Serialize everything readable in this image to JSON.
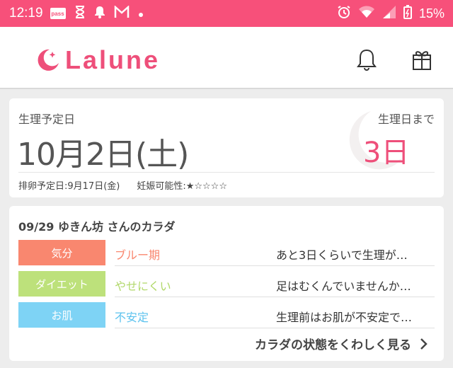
{
  "status_bar": {
    "time": "12:19",
    "pass_badge": "pass",
    "battery_percent": "15%",
    "icons": [
      "pass-icon",
      "hourglass-icon",
      "bell-icon",
      "gmail-icon",
      "dot-icon",
      "alarm-icon",
      "wifi-icon",
      "signal-icon",
      "battery-icon"
    ]
  },
  "header": {
    "logo_text": "Lalune",
    "icons": [
      "notification-bell-icon",
      "gift-icon"
    ]
  },
  "period": {
    "label": "生理予定日",
    "date": "10月2日(土)",
    "days_label": "生理日まで",
    "days_value": "3日",
    "ovulation": "排卵予定日:9月17日(金)",
    "pregnancy": "妊娠可能性:★☆☆☆☆"
  },
  "body": {
    "title": "09/29  ゆきん坊 さんのカラダ",
    "rows": [
      {
        "tag": "気分",
        "status": "ブルー期",
        "desc": "あと3日くらいで生理が…",
        "tag_color": "#f9876f",
        "status_color": "#f9876f"
      },
      {
        "tag": "ダイエット",
        "status": "やせにくい",
        "desc": "足はむくんでいませんか…",
        "tag_color": "#bde17b",
        "status_color": "#b1d86a"
      },
      {
        "tag": "お肌",
        "status": "不安定",
        "desc": "生理前はお肌が不安定で…",
        "tag_color": "#7ed3f5",
        "status_color": "#5bc2ee"
      }
    ],
    "more_link": "カラダの状態をくわしく見る"
  },
  "colors": {
    "accent": "#ee4f7a",
    "status_bar": "#f7507a"
  }
}
